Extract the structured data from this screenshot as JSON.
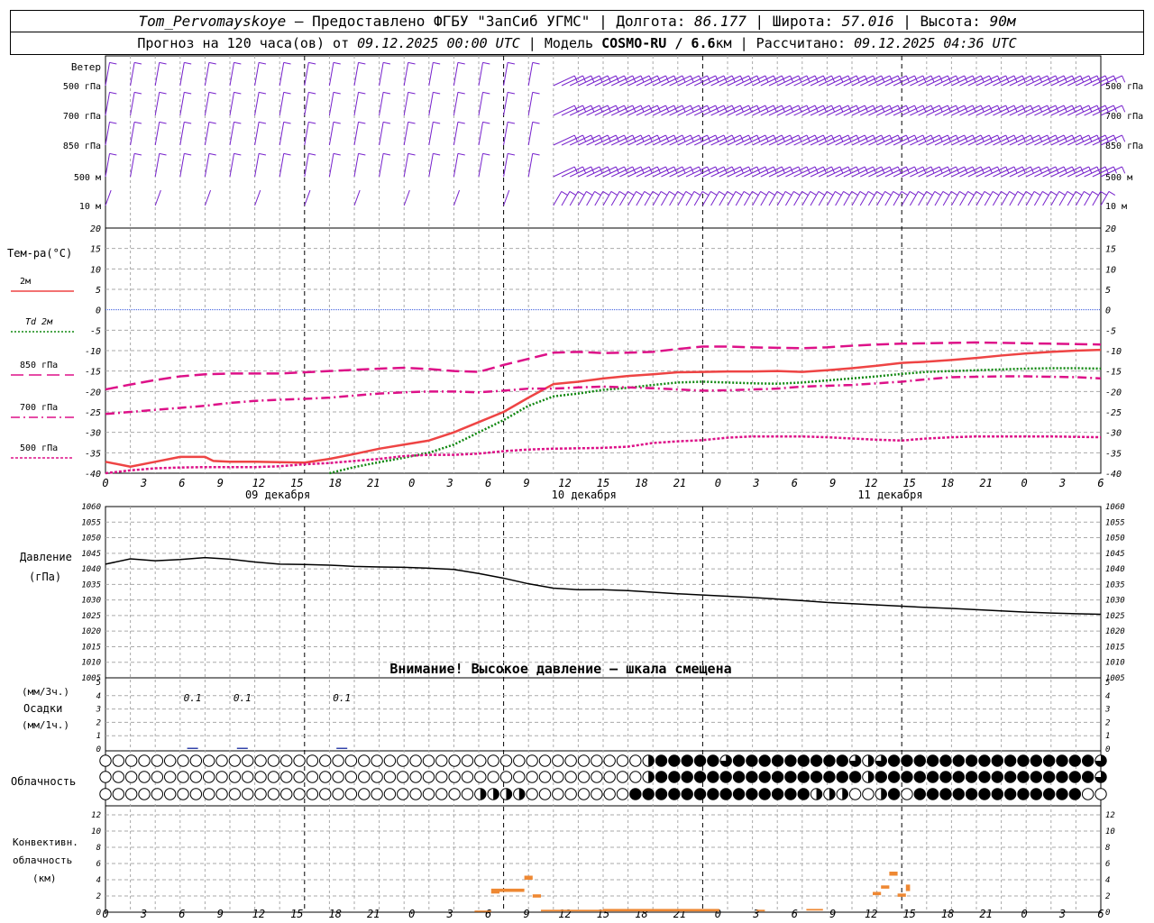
{
  "header": {
    "station": "Tom_Pervomayskoye",
    "provider_prefix": " – Предоставлено ФГБУ \"ЗапСиб УГМС\" | Долгота: ",
    "longitude": "86.177",
    "lat_prefix": " | Широта: ",
    "latitude": "57.016",
    "alt_prefix": " | Высота: ",
    "altitude": "90м",
    "forecast_prefix": "Прогноз на 120 часа(ов) от ",
    "forecast_date": "09.12.2025 00:00 UTC",
    "model_prefix": " | Модель ",
    "model": "COSMO-RU / 6.6",
    "model_unit": "км",
    "calc_prefix": " | Рассчитано: ",
    "calc_date": "09.12.2025 04:36 UTC"
  },
  "wind_panel": {
    "title": "Ветер",
    "levels": [
      "500 гПа",
      "700 гПа",
      "850 гПа",
      "500 м",
      "10 м"
    ],
    "color": "#7722cc"
  },
  "temp_panel": {
    "title": "Тем-ра(°C)",
    "legend": [
      {
        "label": "2м",
        "color": "#ee4444",
        "style": "solid"
      },
      {
        "label": "Td 2м",
        "color": "#118811",
        "style": "dotted"
      },
      {
        "label": "850 гПа",
        "color": "#dd1188",
        "style": "longdash"
      },
      {
        "label": "700 гПа",
        "color": "#dd1188",
        "style": "dashdot"
      },
      {
        "label": "500 гПа",
        "color": "#dd1188",
        "style": "dot"
      }
    ],
    "y_ticks": [
      "20",
      "15",
      "10",
      "5",
      "0",
      "-5",
      "-10",
      "-15",
      "-20",
      "-25",
      "-30",
      "-35",
      "-40"
    ],
    "zero_color": "#3355dd"
  },
  "time_axis": {
    "hours": [
      "0",
      "3",
      "6",
      "9",
      "12",
      "15",
      "18",
      "21",
      "0",
      "3",
      "6",
      "9",
      "12",
      "15",
      "18",
      "21",
      "0",
      "3",
      "6",
      "9",
      "12",
      "15",
      "18",
      "21",
      "0",
      "3",
      "6"
    ],
    "dates": [
      "09 декабря",
      "10 декабря",
      "11 декабря"
    ]
  },
  "pressure_panel": {
    "title": "Давление",
    "unit": "(гПа)",
    "y_ticks": [
      "1060",
      "1055",
      "1050",
      "1045",
      "1040",
      "1035",
      "1030",
      "1025",
      "1020",
      "1015",
      "1010",
      "1005"
    ],
    "warning": "Внимание! Высокое давление – шкала смещена"
  },
  "precip_panel": {
    "unit1": "(мм/3ч.)",
    "title": "Осадки",
    "unit2": "(мм/1ч.)",
    "y_ticks": [
      "5",
      "4",
      "3",
      "2",
      "1",
      "0"
    ],
    "labels": [
      {
        "hour": 10.5,
        "text": "0.1"
      },
      {
        "hour": 16.5,
        "text": "0.1"
      },
      {
        "hour": 28.5,
        "text": "0.1"
      }
    ]
  },
  "cloud_panel": {
    "title": "Облачность",
    "rows": [
      "000000000000000000000000000000000000000000244444344444444432344444444444444443",
      "000000000000000000000000000000000000000000244444444444444442444444444444444443",
      "000000000000000000000000000002222000000004444444444444422200240444444444444400"
    ]
  },
  "conv_panel": {
    "title1": "Конвективн.",
    "title2": "облачность",
    "unit": "(км)",
    "y_ticks": [
      "12",
      "10",
      "8",
      "6",
      "4",
      "2",
      "0"
    ],
    "color": "#ee8833"
  },
  "chart_data": [
    {
      "type": "line",
      "title": "Тем-ра(°C)",
      "x_unit": "hours from 09.12.2025 00:00 UTC",
      "ylim": [
        -40,
        20
      ],
      "series": [
        {
          "name": "2м",
          "x": [
            0,
            3,
            6,
            9,
            12,
            13,
            15,
            18,
            21,
            24,
            27,
            30,
            33,
            36,
            39,
            42,
            45,
            48,
            51,
            54,
            57,
            60,
            63,
            66,
            69,
            72,
            75,
            78,
            81,
            84,
            87,
            90,
            93,
            96,
            99,
            102,
            105,
            108,
            111,
            114,
            117,
            120
          ],
          "values": [
            -37.2,
            -38.4,
            -37.2,
            -36.0,
            -36.0,
            -37.0,
            -37.2,
            -37.2,
            -37.3,
            -37.4,
            -36.5,
            -35.3,
            -34.0,
            -33.0,
            -32.0,
            -30.0,
            -27.5,
            -25.0,
            -21.5,
            -18.2,
            -17.6,
            -16.8,
            -16.2,
            -15.8,
            -15.3,
            -15.2,
            -15.1,
            -15.1,
            -15.0,
            -15.2,
            -14.8,
            -14.3,
            -13.7,
            -13.0,
            -12.7,
            -12.3,
            -11.8,
            -11.2,
            -10.7,
            -10.3,
            -10.0,
            -9.8
          ]
        },
        {
          "name": "Td 2м",
          "x": [
            27,
            30,
            33,
            36,
            39,
            42,
            45,
            48,
            51,
            54,
            57,
            60,
            63,
            66,
            69,
            72,
            75,
            78,
            81,
            84,
            87,
            90,
            93,
            96,
            99,
            102,
            105,
            108,
            111,
            114,
            117,
            120
          ],
          "values": [
            -40.0,
            -38.5,
            -37.3,
            -36.2,
            -35.0,
            -33.0,
            -30.0,
            -27.0,
            -23.5,
            -21.2,
            -20.5,
            -19.6,
            -19.1,
            -18.4,
            -17.8,
            -17.6,
            -17.8,
            -18.0,
            -18.1,
            -17.8,
            -17.3,
            -16.8,
            -16.3,
            -15.7,
            -15.2,
            -15.0,
            -14.8,
            -14.6,
            -14.4,
            -14.3,
            -14.3,
            -14.4
          ]
        },
        {
          "name": "850 гПа",
          "x": [
            0,
            3,
            6,
            9,
            12,
            15,
            18,
            21,
            24,
            27,
            30,
            33,
            36,
            39,
            42,
            45,
            48,
            51,
            54,
            57,
            60,
            63,
            66,
            69,
            72,
            75,
            78,
            81,
            84,
            87,
            90,
            93,
            96,
            99,
            102,
            105,
            108,
            111,
            114,
            117,
            120
          ],
          "values": [
            -19.5,
            -18.3,
            -17.2,
            -16.3,
            -15.8,
            -15.6,
            -15.6,
            -15.6,
            -15.3,
            -15.0,
            -14.7,
            -14.4,
            -14.2,
            -14.5,
            -15.0,
            -15.2,
            -13.5,
            -12.0,
            -10.5,
            -10.3,
            -10.6,
            -10.5,
            -10.3,
            -9.6,
            -9.0,
            -9.0,
            -9.2,
            -9.3,
            -9.4,
            -9.2,
            -8.8,
            -8.5,
            -8.3,
            -8.2,
            -8.1,
            -8.0,
            -8.1,
            -8.2,
            -8.3,
            -8.4,
            -8.5
          ]
        },
        {
          "name": "700 гПа",
          "x": [
            0,
            3,
            6,
            9,
            12,
            15,
            18,
            21,
            24,
            27,
            30,
            33,
            36,
            39,
            42,
            45,
            48,
            51,
            54,
            57,
            60,
            63,
            66,
            69,
            72,
            75,
            78,
            81,
            84,
            87,
            90,
            93,
            96,
            99,
            102,
            105,
            108,
            111,
            114,
            117,
            120
          ],
          "values": [
            -25.5,
            -25.0,
            -24.5,
            -24.0,
            -23.5,
            -22.8,
            -22.3,
            -22.0,
            -21.8,
            -21.5,
            -21.0,
            -20.5,
            -20.2,
            -20.0,
            -20.0,
            -20.2,
            -19.8,
            -19.3,
            -19.3,
            -19.0,
            -18.8,
            -19.0,
            -19.2,
            -19.5,
            -19.8,
            -19.7,
            -19.5,
            -19.3,
            -18.8,
            -18.6,
            -18.4,
            -18.0,
            -17.6,
            -17.0,
            -16.5,
            -16.4,
            -16.3,
            -16.3,
            -16.4,
            -16.5,
            -16.8
          ]
        },
        {
          "name": "500 гПа",
          "x": [
            0,
            3,
            6,
            9,
            12,
            15,
            18,
            21,
            24,
            27,
            30,
            33,
            36,
            39,
            42,
            45,
            48,
            51,
            54,
            57,
            60,
            63,
            66,
            69,
            72,
            75,
            78,
            81,
            84,
            87,
            90,
            93,
            96,
            99,
            102,
            105,
            108,
            111,
            114,
            117,
            120
          ],
          "values": [
            -40.0,
            -39.3,
            -38.8,
            -38.6,
            -38.5,
            -38.5,
            -38.5,
            -38.3,
            -37.8,
            -37.5,
            -37.0,
            -36.5,
            -35.8,
            -35.5,
            -35.5,
            -35.2,
            -34.6,
            -34.2,
            -34.0,
            -33.9,
            -33.8,
            -33.5,
            -32.6,
            -32.2,
            -31.9,
            -31.3,
            -31.0,
            -31.0,
            -31.0,
            -31.2,
            -31.5,
            -31.8,
            -32.0,
            -31.5,
            -31.2,
            -31.0,
            -31.0,
            -31.0,
            -31.0,
            -31.1,
            -31.2
          ]
        }
      ]
    },
    {
      "type": "line",
      "title": "Давление",
      "ylabel": "(гПа)",
      "x_unit": "hours from 09.12.2025 00:00 UTC",
      "ylim": [
        1005,
        1060
      ],
      "series": [
        {
          "name": "Давление",
          "x": [
            0,
            3,
            6,
            9,
            12,
            15,
            18,
            21,
            24,
            27,
            30,
            33,
            36,
            39,
            42,
            45,
            48,
            51,
            54,
            57,
            60,
            63,
            66,
            69,
            72,
            75,
            78,
            81,
            84,
            87,
            90,
            93,
            96,
            99,
            102,
            105,
            108,
            111,
            114,
            117,
            120
          ],
          "values": [
            1041.5,
            1043.2,
            1042.6,
            1043.0,
            1043.6,
            1043.1,
            1042.2,
            1041.5,
            1041.4,
            1041.2,
            1040.8,
            1040.6,
            1040.5,
            1040.2,
            1039.8,
            1038.5,
            1037.0,
            1035.2,
            1033.8,
            1033.3,
            1033.3,
            1033.0,
            1032.5,
            1032.0,
            1031.6,
            1031.2,
            1030.8,
            1030.3,
            1029.8,
            1029.2,
            1028.8,
            1028.4,
            1028.0,
            1027.6,
            1027.3,
            1026.9,
            1026.5,
            1026.1,
            1025.8,
            1025.6,
            1025.4
          ]
        }
      ]
    },
    {
      "type": "bar",
      "title": "Осадки",
      "x_unit": "hours from 09.12.2025 00:00 UTC",
      "ylim": [
        0,
        5
      ],
      "x": [
        10.5,
        16.5,
        28.5
      ],
      "values": [
        0.1,
        0.1,
        0.1
      ]
    },
    {
      "type": "bar",
      "title": "Конвективн. облачность",
      "ylabel": "(км)",
      "x_unit": "hours from 09.12.2025 00:00 UTC",
      "ylim": [
        0,
        13
      ],
      "segments": [
        {
          "x0": 44.5,
          "x1": 46.5,
          "base": 0.1,
          "top": 0.2
        },
        {
          "x0": 46.5,
          "x1": 47.5,
          "base": 2.3,
          "top": 2.9
        },
        {
          "x0": 47.5,
          "x1": 50.5,
          "base": 2.5,
          "top": 2.9
        },
        {
          "x0": 50.5,
          "x1": 51.5,
          "base": 4.0,
          "top": 4.5
        },
        {
          "x0": 51.5,
          "x1": 52.5,
          "base": 1.8,
          "top": 2.2
        },
        {
          "x0": 52.5,
          "x1": 60.0,
          "base": 0.1,
          "top": 0.3
        },
        {
          "x0": 60.0,
          "x1": 74.0,
          "base": 0.1,
          "top": 0.4
        },
        {
          "x0": 78.5,
          "x1": 79.5,
          "base": 0.1,
          "top": 0.3
        },
        {
          "x0": 84.5,
          "x1": 86.5,
          "base": 0.2,
          "top": 0.4
        },
        {
          "x0": 92.5,
          "x1": 93.5,
          "base": 2.1,
          "top": 2.5
        },
        {
          "x0": 93.5,
          "x1": 94.5,
          "base": 2.9,
          "top": 3.3
        },
        {
          "x0": 94.5,
          "x1": 95.5,
          "base": 4.5,
          "top": 5.0
        },
        {
          "x0": 95.5,
          "x1": 96.5,
          "base": 1.9,
          "top": 2.3
        },
        {
          "x0": 96.5,
          "x1": 97.0,
          "base": 2.6,
          "top": 3.4
        }
      ]
    }
  ]
}
